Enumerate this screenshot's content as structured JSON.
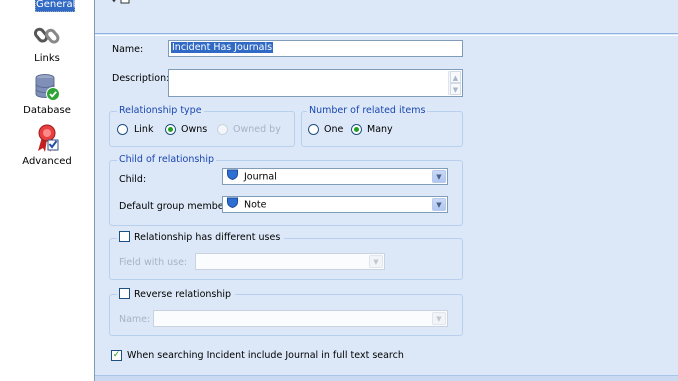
{
  "sidebar": {
    "items": [
      {
        "label": "General",
        "icon": "general-icon"
      },
      {
        "label": "Links",
        "icon": "chain-link-icon"
      },
      {
        "label": "Database",
        "icon": "database-icon"
      },
      {
        "label": "Advanced",
        "icon": "ribbon-icon"
      }
    ]
  },
  "form": {
    "name_label": "Name:",
    "name_value": "Incident Has Journals",
    "description_label": "Description:",
    "description_value": "",
    "relationship_type": {
      "title": "Relationship type",
      "options": [
        "Link",
        "Owns",
        "Owned by"
      ],
      "selected": "Owns"
    },
    "related_items": {
      "title": "Number of related items",
      "options": [
        "One",
        "Many"
      ],
      "selected": "Many"
    },
    "child_group": {
      "title": "Child of relationship",
      "child_label": "Child:",
      "child_value": "Journal",
      "default_member_label": "Default group member:",
      "default_member_value": "Note"
    },
    "uses_group": {
      "checkbox_label": "Relationship has different uses",
      "checked": false,
      "field_label": "Field with use:",
      "field_value": ""
    },
    "reverse_group": {
      "checkbox_label": "Reverse relationship",
      "checked": false,
      "name_label": "Name:",
      "name_value": ""
    },
    "fulltext": {
      "label": "When searching Incident include Journal in full text search",
      "checked": true
    }
  },
  "colors": {
    "panel_bg": "#dce8f8",
    "group_title": "#1a47b0",
    "selection": "#316ac5",
    "check_green": "#21a121"
  }
}
